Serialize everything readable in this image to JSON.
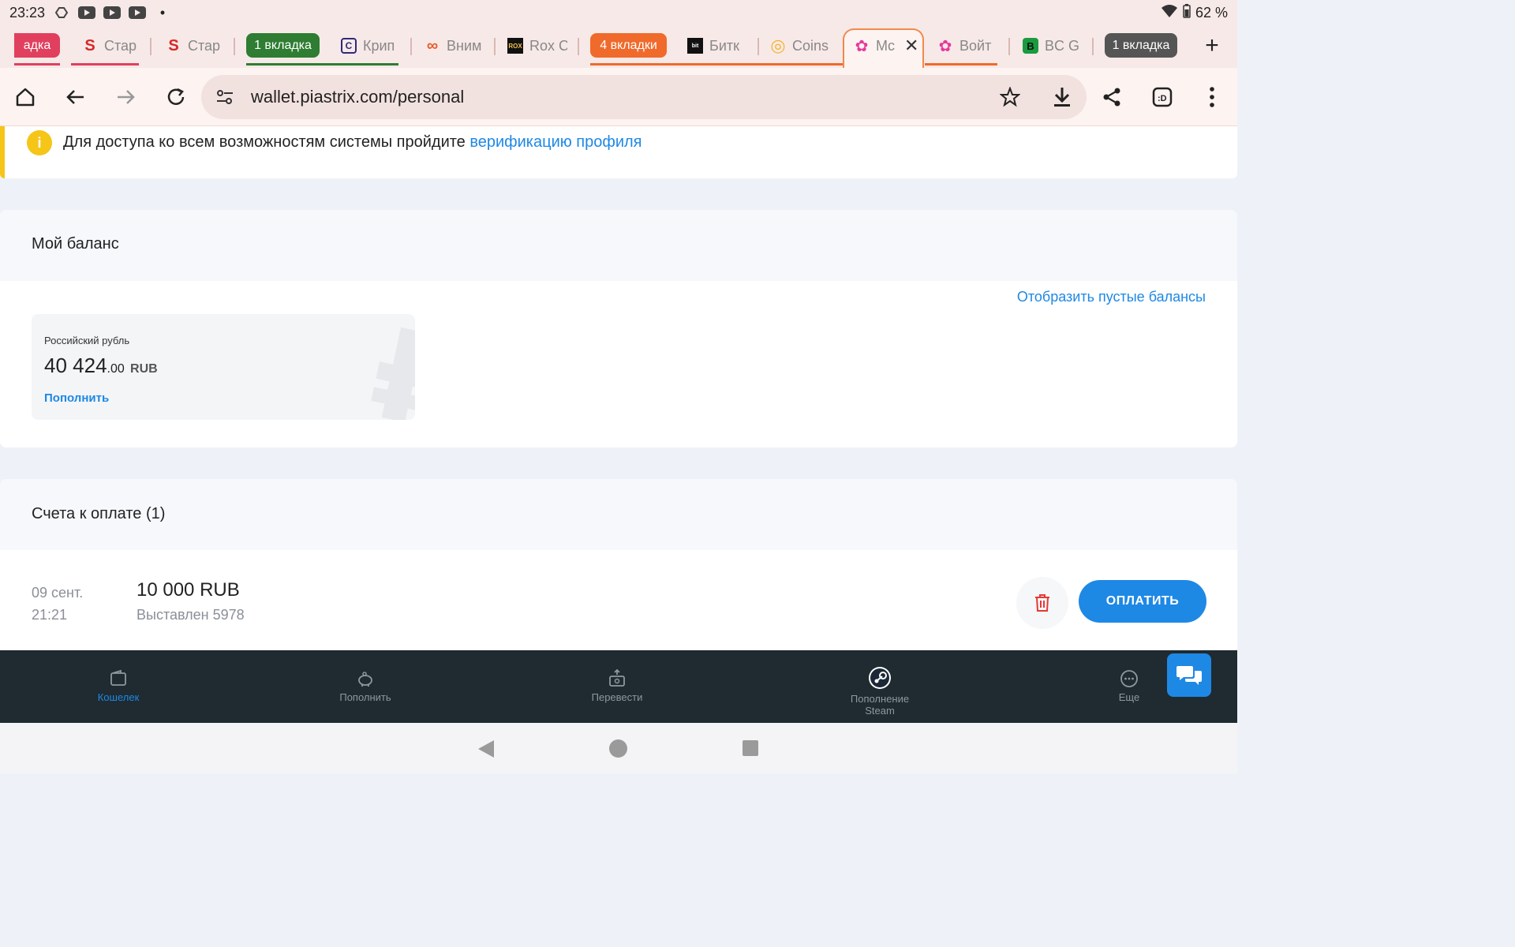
{
  "status_bar": {
    "time": "23:23",
    "battery": "62 %"
  },
  "tabs": [
    {
      "title": "адка",
      "type": "group-tail",
      "color": "#e0405e"
    },
    {
      "title": "Стар",
      "favicon": "S",
      "favicon_color": "#d62828"
    },
    {
      "title": "Стар",
      "favicon": "S",
      "favicon_color": "#d62828"
    },
    {
      "title": "1 вкладка",
      "type": "group",
      "color": "#2e7d32"
    },
    {
      "title": "Крип",
      "favicon": "C",
      "favicon_color": "#2d2a7a"
    },
    {
      "title": "Вним",
      "favicon": "∞",
      "favicon_color": "#e85a2a"
    },
    {
      "title": "Rox C",
      "favicon": "ROX",
      "favicon_color": "#111"
    },
    {
      "title": "4 вкладки",
      "type": "group",
      "color": "#f06a2b"
    },
    {
      "title": "Битк",
      "favicon": "bit",
      "favicon_color": "#111"
    },
    {
      "title": "Coins",
      "favicon": "◎",
      "favicon_color": "#f2b62b"
    },
    {
      "title": "Mc",
      "favicon": "✿",
      "favicon_color": "#e6399b",
      "active": true
    },
    {
      "title": "Войт",
      "favicon": "✿",
      "favicon_color": "#e6399b"
    },
    {
      "title": "BC G",
      "favicon": "B",
      "favicon_color": "#1a9b3f"
    },
    {
      "title": "1 вкладка",
      "type": "group",
      "color": "#555"
    }
  ],
  "address_bar": {
    "url": "wallet.piastrix.com/personal"
  },
  "banner": {
    "text": "Для доступа ко всем возможностям системы пройдите ",
    "link": "верификацию профиля"
  },
  "balance_section": {
    "title": "Мой баланс",
    "show_empty_link": "Отобразить пустые балансы",
    "card": {
      "currency_name": "Российский рубль",
      "amount_int": "40 424",
      "amount_dec": ".00",
      "currency_code": "RUB",
      "topup_label": "Пополнить",
      "watermark": "₽"
    }
  },
  "invoices_section": {
    "title": "Счета к оплате (1)",
    "items": [
      {
        "date": "09 сент.",
        "time": "21:21",
        "amount": "10 000 RUB",
        "subtitle": "Выставлен 5978",
        "pay_label": "ОПЛАТИТЬ"
      }
    ]
  },
  "bottom_nav": [
    {
      "label": "Кошелек",
      "icon": "wallet-icon",
      "active": true
    },
    {
      "label": "Пополнить",
      "icon": "piggy-bank-icon",
      "active": false
    },
    {
      "label": "Перевести",
      "icon": "transfer-icon",
      "active": false
    },
    {
      "label": "Пополнение",
      "label2": "Steam",
      "icon": "steam-icon",
      "active": false
    },
    {
      "label": "Еще",
      "icon": "more-icon",
      "active": false
    }
  ],
  "colors": {
    "accent": "#1e88e5",
    "warning": "#f5c518",
    "danger": "#e53935",
    "nav_bg": "#1f2b30"
  }
}
